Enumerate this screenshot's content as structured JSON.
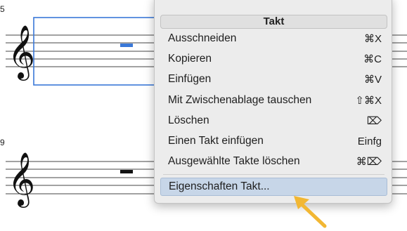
{
  "score": {
    "staff_color": "#444444",
    "selection_color": "#3a78d8",
    "clef_icon": "treble-clef-icon",
    "rest_icon": "whole-rest-icon"
  },
  "menu": {
    "header": "Takt",
    "items": [
      {
        "label": "Ausschneiden",
        "shortcut": "⌘X"
      },
      {
        "label": "Kopieren",
        "shortcut": "⌘C"
      },
      {
        "label": "Einfügen",
        "shortcut": "⌘V"
      },
      {
        "label": "Mit Zwischenablage tauschen",
        "shortcut": "⇧⌘X"
      },
      {
        "label": "Löschen",
        "shortcut": "⌦"
      },
      {
        "label": "Einen Takt einfügen",
        "shortcut": "Einfg"
      },
      {
        "label": "Ausgewählte Takte löschen",
        "shortcut": "⌘⌦"
      },
      {
        "label": "Eigenschaften Takt..."
      }
    ],
    "selected_index": 7,
    "highlight_color": "#c7d6e8"
  },
  "annotation": {
    "arrow_color": "#f2b733",
    "arrow_icon": "arrow-pointer-icon"
  }
}
